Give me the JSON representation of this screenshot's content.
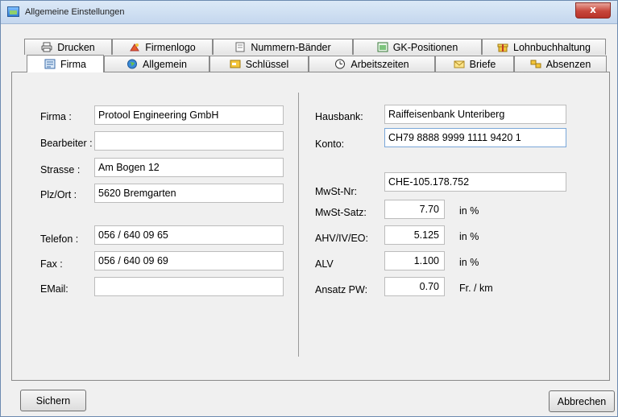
{
  "window": {
    "title": "Allgemeine Einstellungen",
    "close_glyph": "x"
  },
  "tabs_back": [
    {
      "label": "Drucken",
      "icon": "printer-icon"
    },
    {
      "label": "Firmenlogo",
      "icon": "paint-icon"
    },
    {
      "label": "Nummern-Bänder",
      "icon": "document-icon"
    },
    {
      "label": "GK-Positionen",
      "icon": "window-icon"
    },
    {
      "label": "Lohnbuchhaltung",
      "icon": "gift-icon"
    }
  ],
  "tabs_front": [
    {
      "label": "Firma",
      "icon": "form-icon",
      "active": true
    },
    {
      "label": "Allgemein",
      "icon": "globe-icon"
    },
    {
      "label": "Schlüssel",
      "icon": "key-card-icon"
    },
    {
      "label": "Arbeitszeiten",
      "icon": "clock-icon"
    },
    {
      "label": "Briefe",
      "icon": "envelope-icon"
    },
    {
      "label": "Absenzen",
      "icon": "users-icon"
    }
  ],
  "left": {
    "firma": {
      "label": "Firma :",
      "value": "Protool Engineering GmbH"
    },
    "bearbeiter": {
      "label": "Bearbeiter :",
      "value": ""
    },
    "strasse": {
      "label": "Strasse :",
      "value": "Am Bogen 12"
    },
    "plzort": {
      "label": "Plz/Ort :",
      "value": "5620 Bremgarten"
    },
    "telefon": {
      "label": "Telefon :",
      "value": "056 / 640 09 65"
    },
    "fax": {
      "label": "Fax :",
      "value": "056 / 640 09 69"
    },
    "email": {
      "label": "EMail:",
      "value": ""
    }
  },
  "right": {
    "hausbank": {
      "label": "Hausbank:",
      "value": "Raiffeisenbank Unteriberg"
    },
    "konto": {
      "label": "Konto:",
      "value": "CH79 8888 9999 1111 9420 1"
    },
    "mwst_nr": {
      "label": "MwSt-Nr:",
      "value": "CHE-105.178.752"
    },
    "mwst_satz": {
      "label": "MwSt-Satz:",
      "value": "7.70",
      "unit": "in %"
    },
    "ahv": {
      "label": "AHV/IV/EO:",
      "value": "5.125",
      "unit": "in %"
    },
    "alv": {
      "label": "ALV",
      "value": "1.100",
      "unit": "in %"
    },
    "ansatz_pw": {
      "label": "Ansatz PW:",
      "value": "0.70",
      "unit": "Fr. / km"
    }
  },
  "buttons": {
    "save": "Sichern",
    "cancel": "Abbrechen"
  }
}
